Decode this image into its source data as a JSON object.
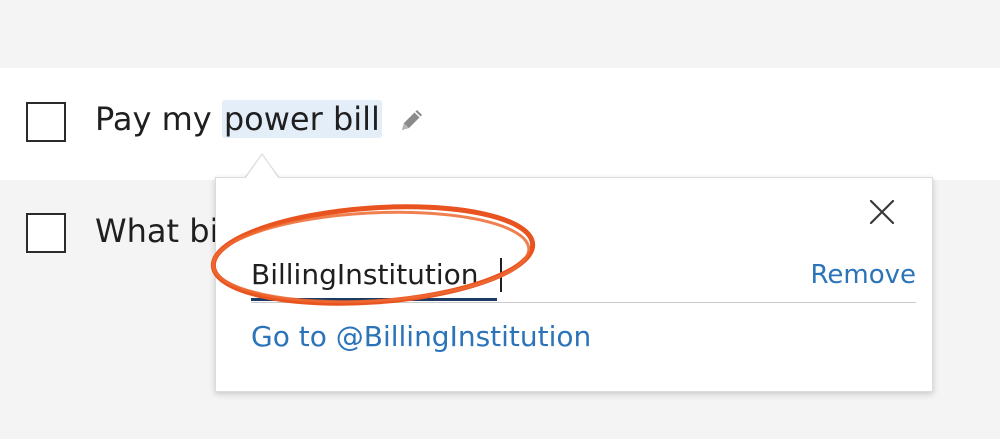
{
  "tasks": [
    {
      "prefix": "Pay my ",
      "highlight": "power bill",
      "checked": false
    },
    {
      "text": "What bi",
      "checked": false
    }
  ],
  "link_popover": {
    "input_value": "BillingInstitution",
    "remove_label": "Remove",
    "goto_label": "Go to @BillingInstitution",
    "close_icon": "close-icon"
  },
  "icons": {
    "edit": "pencil-icon"
  },
  "colors": {
    "link": "#2b74b9",
    "highlight": "#e3eef9",
    "annotation": "#e8531f",
    "input_underline": "#1b3b63"
  }
}
